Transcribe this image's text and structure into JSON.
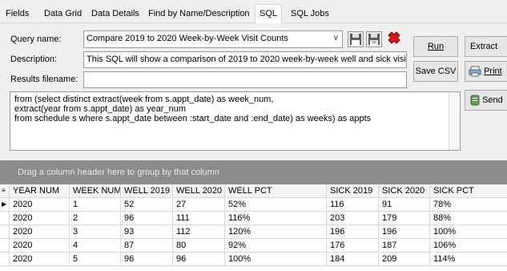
{
  "tabs": [
    {
      "label": "Fields"
    },
    {
      "label": "Data Grid"
    },
    {
      "label": "Data Details"
    },
    {
      "label": "Find by Name/Description"
    },
    {
      "label": "SQL"
    },
    {
      "label": "SQL Jobs"
    }
  ],
  "form": {
    "query_name_label": "Query name:",
    "query_name_value": "Compare 2019 to 2020 Week-by-Week Visit Counts",
    "description_label": "Description:",
    "description_value": "This SQL will show a comparison of 2019 to 2020 week-by-week well and sick visits",
    "results_filename_label": "Results filename:",
    "results_filename_value": ""
  },
  "buttons": {
    "run": "Run",
    "extract": "Extract",
    "save_csv": "Save CSV",
    "print": "Print",
    "send": "Send"
  },
  "icons": {
    "save": "floppy-save-icon",
    "save_as": "floppy-save-as-icon",
    "delete": "delete-x-icon",
    "print": "printer-icon",
    "send": "send-icon"
  },
  "sql_lines": [
    "from (select distinct extract(week from s.appt_date) as week_num,",
    "extract(year from s.appt_date) as year_num",
    "from schedule s where s.appt_date between :start_date and :end_date) as weeks) as appts"
  ],
  "group_bar_text": "Drag a column header here to group by that column",
  "grid": {
    "columns": [
      "YEAR NUM",
      "WEEK NUM",
      "WELL 2019",
      "WELL 2020",
      "WELL PCT",
      "SICK 2019",
      "SICK 2020",
      "SICK PCT"
    ],
    "rows": [
      [
        "2020",
        "1",
        "52",
        "27",
        "52%",
        "116",
        "91",
        "78%"
      ],
      [
        "2020",
        "2",
        "96",
        "111",
        "116%",
        "203",
        "179",
        "88%"
      ],
      [
        "2020",
        "3",
        "93",
        "112",
        "120%",
        "196",
        "196",
        "100%"
      ],
      [
        "2020",
        "4",
        "87",
        "80",
        "92%",
        "176",
        "187",
        "106%"
      ],
      [
        "2020",
        "5",
        "96",
        "96",
        "100%",
        "184",
        "209",
        "114%"
      ]
    ]
  },
  "colors": {
    "delete_red": "#d01818",
    "group_bar": "#8c8c8c"
  }
}
